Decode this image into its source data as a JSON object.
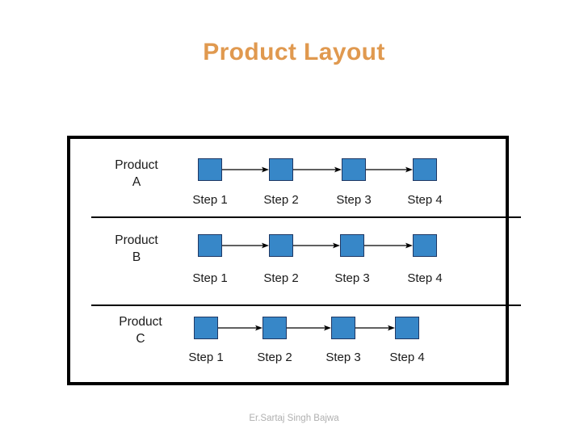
{
  "slide": {
    "title": "Product Layout",
    "title_color": "#E0994F",
    "footer_credit": "Er.Sartaj Singh Bajwa",
    "footer_color": "#B0B0B0",
    "background": "#FFFFFF"
  },
  "diagram": {
    "frame_border_color": "#000000",
    "divider_color": "#000000",
    "box_fill": "#3787C8",
    "box_border": "#1F3864",
    "arrow_color": "#000000",
    "rows": [
      {
        "product_name": "Product",
        "product_letter": "A",
        "steps": [
          {
            "label": "Step 1"
          },
          {
            "label": "Step 2"
          },
          {
            "label": "Step 3"
          },
          {
            "label": "Step 4"
          }
        ]
      },
      {
        "product_name": "Product",
        "product_letter": "B",
        "steps": [
          {
            "label": "Step 1"
          },
          {
            "label": "Step 2"
          },
          {
            "label": "Step 3"
          },
          {
            "label": "Step 4"
          }
        ]
      },
      {
        "product_name": "Product",
        "product_letter": "C",
        "steps": [
          {
            "label": "Step 1"
          },
          {
            "label": "Step 2"
          },
          {
            "label": "Step 3"
          },
          {
            "label": "Step 4"
          }
        ]
      }
    ]
  }
}
